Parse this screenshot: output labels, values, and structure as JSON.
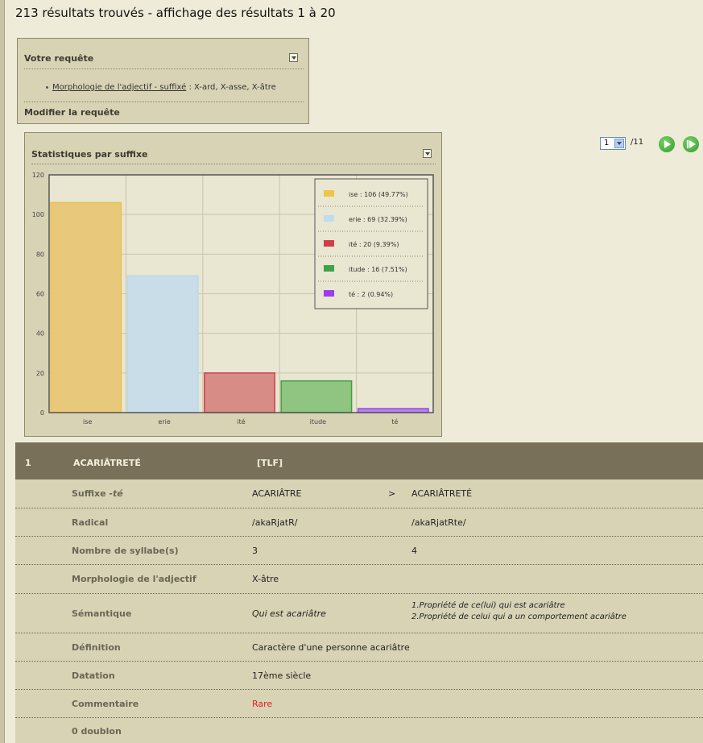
{
  "header": {
    "title": "213 résultats trouvés - affichage des résultats 1 à 20"
  },
  "query": {
    "title": "Votre requête",
    "item_link": "Morphologie de l'adjectif - suffixé",
    "item_rest": " : X-ard, X-asse, X-âtre",
    "modify": "Modifier la requête"
  },
  "stats": {
    "title": "Statistiques par suffixe"
  },
  "pager": {
    "current": "1",
    "total": "/11"
  },
  "chart_data": {
    "type": "bar",
    "categories": [
      "ise",
      "erie",
      "ité",
      "itude",
      "té"
    ],
    "values": [
      106,
      69,
      20,
      16,
      2
    ],
    "colors": [
      "#e8c87a",
      "#c8dde8",
      "#d78d86",
      "#8fc481",
      "#b08ae0"
    ],
    "borders": [
      "#e8c050",
      "#b8d8ec",
      "#d04050",
      "#40a040",
      "#a040f0"
    ],
    "swatch": [
      "#eec44a",
      "#bddcf0",
      "#cf3f48",
      "#3da248",
      "#9a3ef0"
    ],
    "legend": [
      "ise : 106 (49.77%)",
      "erie : 69 (32.39%)",
      "ité : 20 (9.39%)",
      "itude : 16 (7.51%)",
      "té : 2 (0.94%)"
    ],
    "legend_position": "top-right",
    "ylim": [
      0,
      120
    ],
    "yticks": [
      "0",
      "20",
      "40",
      "60",
      "80",
      "100",
      "120"
    ],
    "grid": true
  },
  "result": {
    "number": "1",
    "word": "ACARIÂTRETÉ",
    "source": "[TLF]",
    "rows": [
      {
        "label_a": "Suffixe ",
        "label_b": "-té",
        "base": "ACARIÂTRE",
        "sep": ">",
        "derived": "ACARIÂTRETÉ"
      },
      {
        "label": "Radical",
        "base": "/akaRjatR/",
        "derived": "/akaRjatRte/"
      },
      {
        "label": "Nombre de syllabe(s)",
        "base": "3",
        "derived": "4"
      },
      {
        "label": "Morphologie de l'adjectif",
        "base": "X-âtre"
      },
      {
        "label": "Sémantique",
        "base": "Qui est acariâtre",
        "derived_1": "1.Propriété de ce(lui) qui est acariâtre",
        "derived_2": "2.Propriété de celui qui a un comportement acariâtre"
      },
      {
        "label": "Définition",
        "base": "Caractère d'une personne acariâtre"
      },
      {
        "label": "Datation",
        "base": "17ème siècle"
      },
      {
        "label": "Commentaire",
        "base": "Rare"
      },
      {
        "label": "0 doublon"
      }
    ]
  }
}
